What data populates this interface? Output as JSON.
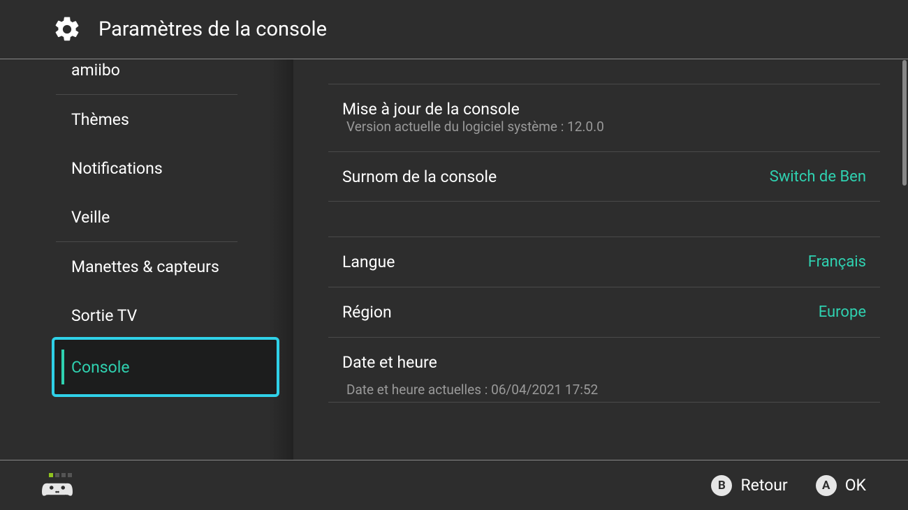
{
  "header": {
    "title": "Paramètres de la console"
  },
  "sidebar": {
    "items": [
      {
        "label": "amiibo"
      },
      {
        "label": "Thèmes"
      },
      {
        "label": "Notifications"
      },
      {
        "label": "Veille"
      },
      {
        "label": "Manettes & capteurs"
      },
      {
        "label": "Sortie TV"
      },
      {
        "label": "Console",
        "selected": true
      }
    ]
  },
  "content": {
    "system_update": {
      "label": "Mise à jour de la console",
      "subtext": "Version actuelle du logiciel système : 12.0.0"
    },
    "nickname": {
      "label": "Surnom de la console",
      "value": "Switch de Ben"
    },
    "language": {
      "label": "Langue",
      "value": "Français"
    },
    "region": {
      "label": "Région",
      "value": "Europe"
    },
    "datetime": {
      "label": "Date et heure",
      "subtext": "Date et heure actuelles : 06/04/2021 17:52"
    }
  },
  "footer": {
    "back": {
      "button": "B",
      "label": "Retour"
    },
    "ok": {
      "button": "A",
      "label": "OK"
    }
  },
  "colors": {
    "accent": "#2fd1b0",
    "highlight_border": "#2fd1e8",
    "background": "#2d2d2d"
  }
}
